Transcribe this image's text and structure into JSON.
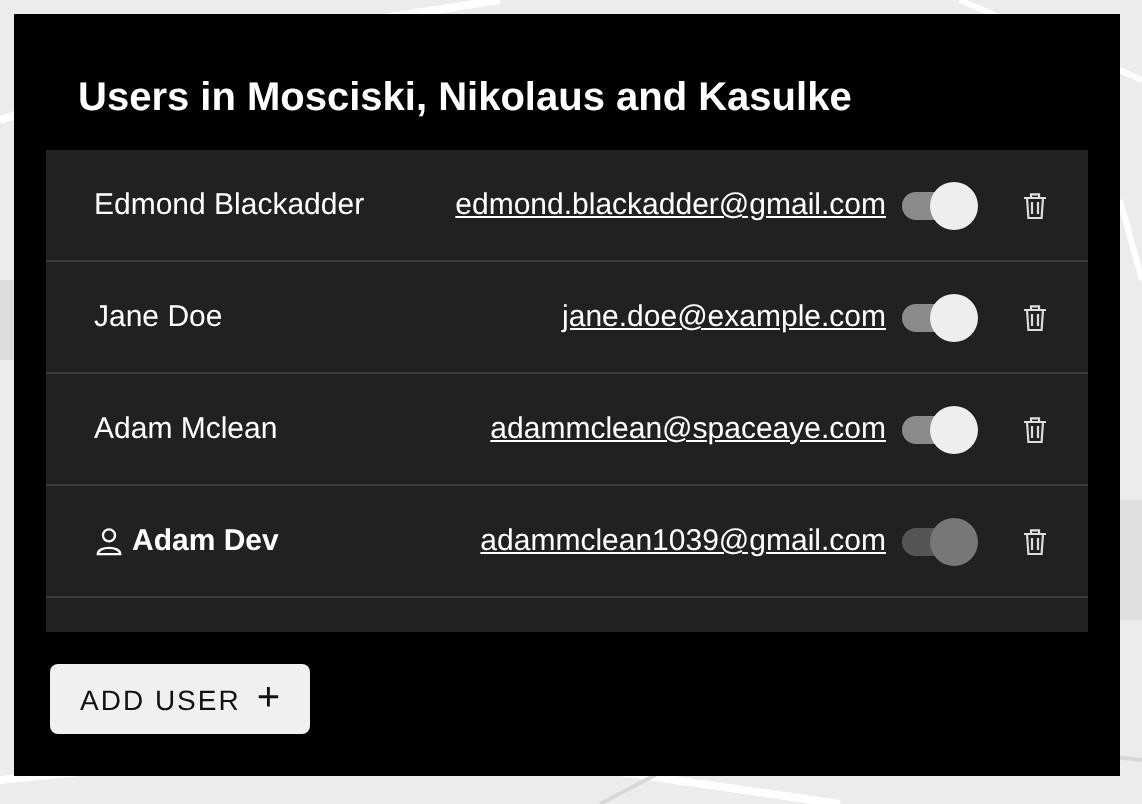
{
  "dialog": {
    "title": "Users in Mosciski, Nikolaus and Kasulke"
  },
  "users": [
    {
      "name": "Edmond Blackadder",
      "email": "edmond.blackadder@gmail.com",
      "current": false,
      "on": true,
      "disabled": false
    },
    {
      "name": "Jane Doe",
      "email": "jane.doe@example.com",
      "current": false,
      "on": true,
      "disabled": false
    },
    {
      "name": "Adam Mclean",
      "email": "adammclean@spaceaye.com",
      "current": false,
      "on": true,
      "disabled": false
    },
    {
      "name": "Adam Dev",
      "email": "adammclean1039@gmail.com",
      "current": true,
      "on": true,
      "disabled": true
    }
  ],
  "add_button": {
    "label": "ADD USER",
    "icon": "+"
  }
}
